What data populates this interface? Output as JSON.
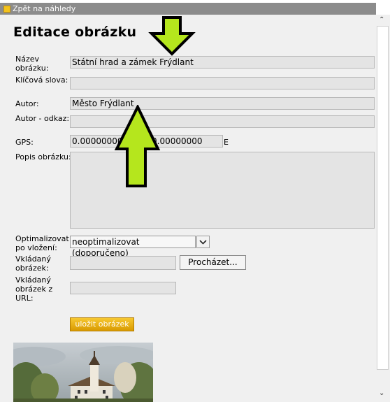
{
  "topbar": {
    "back_label": "Zpět na náhledy"
  },
  "page_title": "Editace obrázku",
  "form": {
    "name_label": "Název obrázku:",
    "name_value": "Státní hrad a zámek Frýdlant",
    "keywords_label": "Klíčová slova:",
    "keywords_value": "",
    "author_label": "Autor:",
    "author_value": "Město Frýdlant",
    "author_link_label": "Autor - odkaz:",
    "author_link_value": "",
    "gps_label": "GPS:",
    "gps_lat": "0.00000000",
    "gps_lon": "0.00000000",
    "gps_suffix": "E",
    "desc_label": "Popis obrázku:",
    "optimize_label": "Optimalizovat po vložení:",
    "optimize_selected": "neoptimalizovat (doporučeno)",
    "upload_label": "Vkládaný obrázek:",
    "browse_label": "Procházet...",
    "upload_url_label": "Vkládaný obrázek z URL:",
    "submit_label": "uložit obrázek"
  },
  "icons": {
    "down_arrow": "down-arrow-annotation",
    "up_arrow": "up-arrow-annotation",
    "select_caret": "chevron-down-icon"
  },
  "colors": {
    "annotation_arrow": "#b5e61d",
    "submit_button": "#e0a400",
    "topbar": "#8c8c8c"
  }
}
